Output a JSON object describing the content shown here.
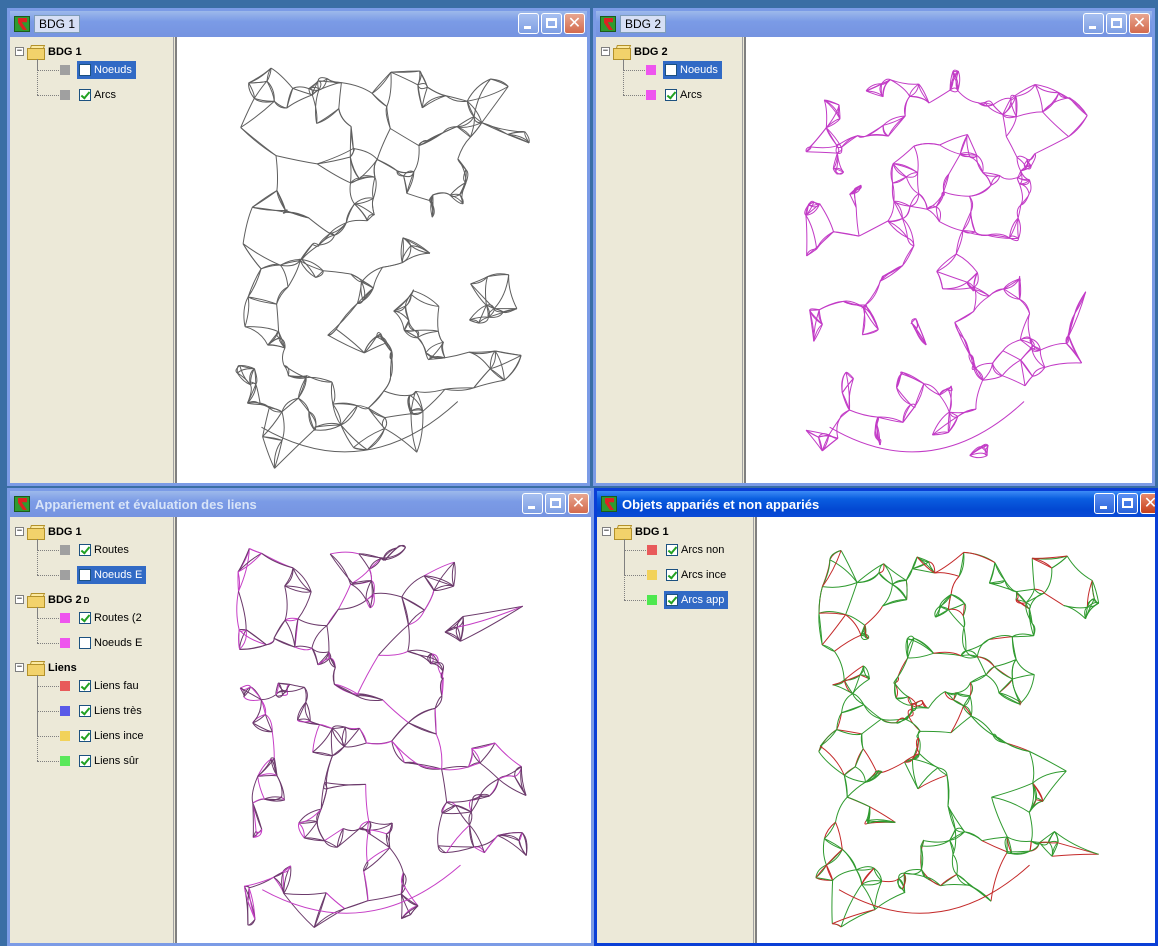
{
  "windows": [
    {
      "id": "w1",
      "title": "BDG 1",
      "title_style": "tab",
      "tree": [
        {
          "type": "group",
          "label": "BDG 1",
          "sup": ""
        },
        {
          "type": "layer",
          "label": "Noeuds",
          "color": "#a0a0a0",
          "checked": false,
          "selected": true
        },
        {
          "type": "layer",
          "label": "Arcs",
          "color": "#a0a0a0",
          "checked": true,
          "selected": false
        }
      ],
      "map": {
        "stroke": "#5f5f5f",
        "seed": 11
      }
    },
    {
      "id": "w2",
      "title": "BDG 2",
      "title_style": "tab",
      "tree": [
        {
          "type": "group",
          "label": "BDG 2",
          "sup": ""
        },
        {
          "type": "layer",
          "label": "Noeuds",
          "color": "#ee55ee",
          "checked": false,
          "selected": true
        },
        {
          "type": "layer",
          "label": "Arcs",
          "color": "#ee55ee",
          "checked": true,
          "selected": false
        }
      ],
      "map": {
        "stroke": "#c23bc6",
        "seed": 23
      }
    },
    {
      "id": "w3",
      "title": "Appariement et évaluation des liens",
      "title_style": "bold",
      "tree": [
        {
          "type": "group",
          "label": "BDG 1",
          "sup": ""
        },
        {
          "type": "layer",
          "label": "Routes",
          "color": "#a0a0a0",
          "checked": true,
          "selected": false
        },
        {
          "type": "layer",
          "label": "Noeuds E",
          "color": "#a0a0a0",
          "checked": false,
          "selected": true
        },
        {
          "type": "group",
          "label": "BDG 2",
          "sup": "D"
        },
        {
          "type": "layer",
          "label": "Routes (2",
          "color": "#ee55ee",
          "checked": true,
          "selected": false
        },
        {
          "type": "layer",
          "label": "Noeuds E",
          "color": "#ee55ee",
          "checked": false,
          "selected": false
        },
        {
          "type": "group",
          "label": "Liens",
          "sup": ""
        },
        {
          "type": "layer",
          "label": "Liens fau",
          "color": "#e85a5a",
          "checked": true,
          "selected": false
        },
        {
          "type": "layer",
          "label": "Liens très",
          "color": "#5a5ae8",
          "checked": true,
          "selected": false
        },
        {
          "type": "layer",
          "label": "Liens ince",
          "color": "#f2d25a",
          "checked": true,
          "selected": false
        },
        {
          "type": "layer",
          "label": "Liens sûr",
          "color": "#5ae85a",
          "checked": true,
          "selected": false
        }
      ],
      "map": {
        "stroke": "#6b3a6b",
        "stroke2": "#c63fc6",
        "seed": 31
      }
    },
    {
      "id": "w4",
      "title": "Objets appariés et non appariés",
      "title_style": "bold",
      "tree": [
        {
          "type": "group",
          "label": "BDG 1",
          "sup": ""
        },
        {
          "type": "layer",
          "label": "Arcs non",
          "color": "#e85a5a",
          "checked": true,
          "selected": false
        },
        {
          "type": "layer",
          "label": "Arcs ince",
          "color": "#f2d25a",
          "checked": true,
          "selected": false
        },
        {
          "type": "layer",
          "label": "Arcs app",
          "color": "#4ee84e",
          "checked": true,
          "selected": true
        }
      ],
      "map": {
        "stroke": "#2f9a2f",
        "stroke2": "#c42a2a",
        "seed": 47
      }
    }
  ]
}
